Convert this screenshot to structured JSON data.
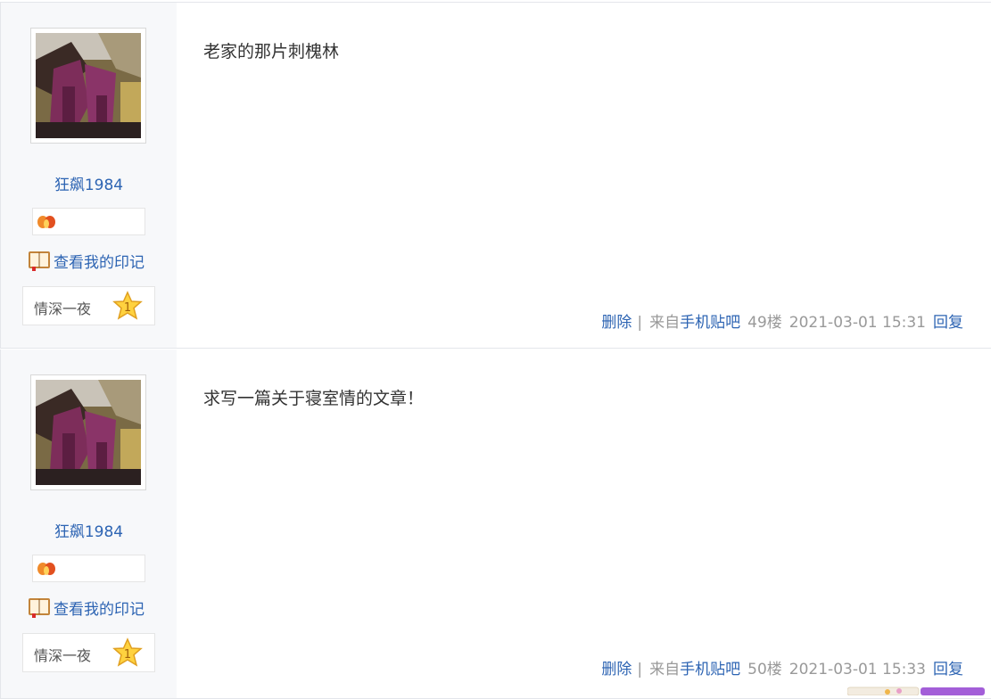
{
  "posts": [
    {
      "author": "狂飙1984",
      "imprint_label": "查看我的印记",
      "level_name": "情深一夜",
      "level_number": "1",
      "content": "老家的那片刺槐林",
      "actions": {
        "delete": "删除",
        "separator": "|",
        "from_prefix": "来自",
        "from_source": "手机贴吧",
        "floor": "49楼",
        "timestamp": "2021-03-01 15:31",
        "reply": "回复"
      }
    },
    {
      "author": "狂飙1984",
      "imprint_label": "查看我的印记",
      "level_name": "情深一夜",
      "level_number": "1",
      "content": "求写一篇关于寝室情的文章！",
      "actions": {
        "delete": "删除",
        "separator": "|",
        "from_prefix": "来自",
        "from_source": "手机贴吧",
        "floor": "50楼",
        "timestamp": "2021-03-01 15:33",
        "reply": "回复"
      }
    }
  ],
  "colors": {
    "link": "#2d64b3",
    "author_bg": "#f7f8fa",
    "meta_text": "#999999"
  },
  "icons": {
    "badge": "flame-badge-icon",
    "imprint": "book-icon",
    "level": "star-level-icon"
  }
}
